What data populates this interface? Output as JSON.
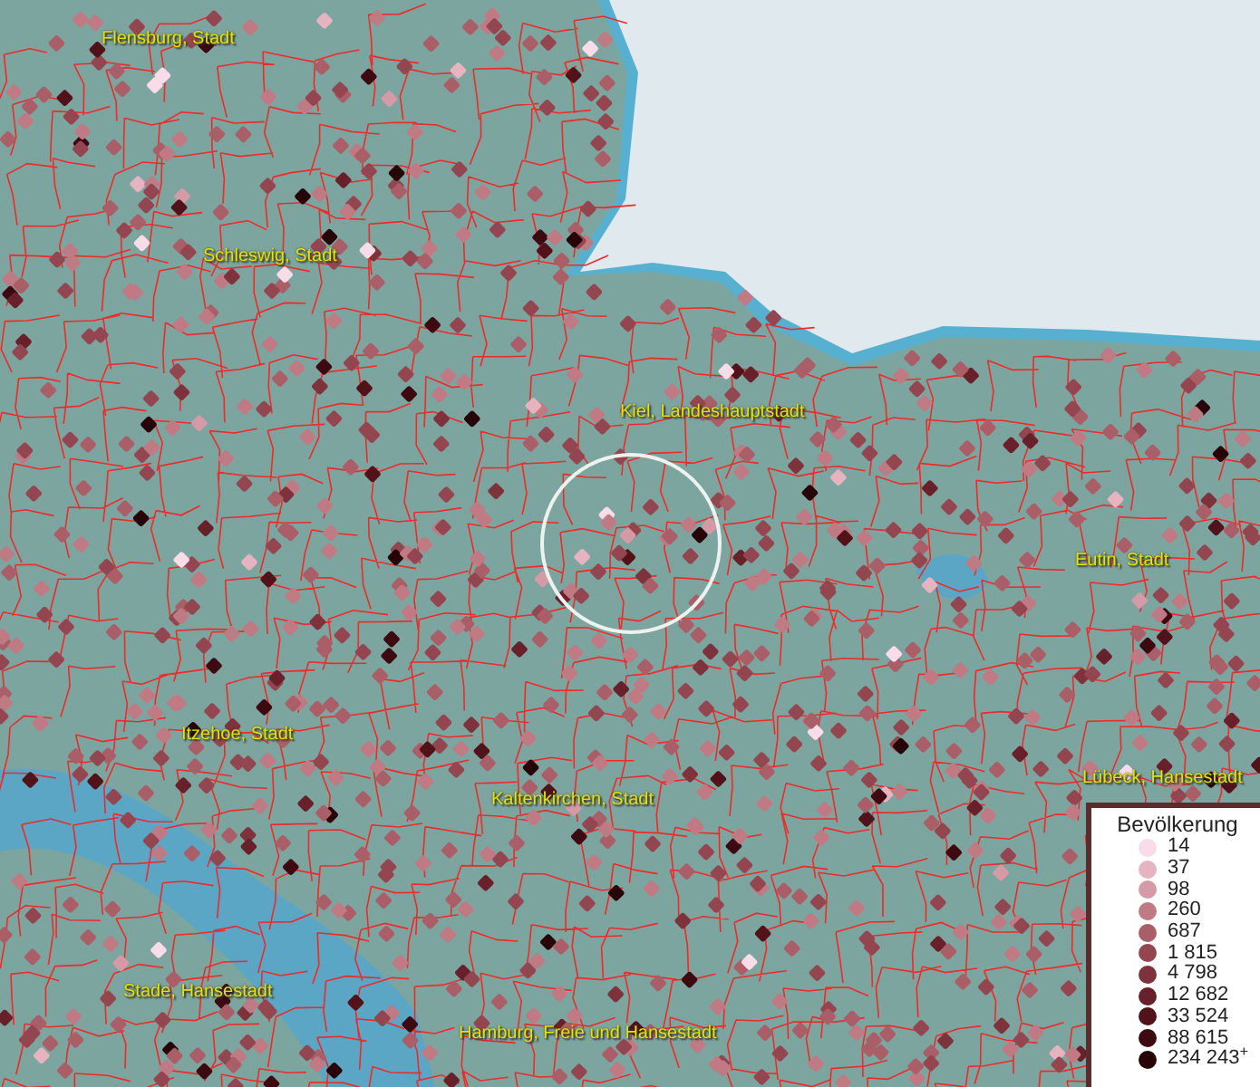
{
  "places": [
    {
      "label": "Flensburg, Stadt"
    },
    {
      "label": "Schleswig, Stadt"
    },
    {
      "label": "Kiel, Landeshauptstadt"
    },
    {
      "label": "Eutin, Stadt"
    },
    {
      "label": "Itzehoe, Stadt"
    },
    {
      "label": "Kaltenkirchen, Stadt"
    },
    {
      "label": "Lübeck, Hansestadt"
    },
    {
      "label": "Stade, Hansestadt"
    },
    {
      "label": "Hamburg, Freie und Hansestadt"
    }
  ],
  "legend": {
    "title": "Bevölkerung",
    "items": [
      {
        "label": "14",
        "color": "#f8dce8"
      },
      {
        "label": "37",
        "color": "#e6b4c0"
      },
      {
        "label": "98",
        "color": "#d49aa6"
      },
      {
        "label": "260",
        "color": "#c07a84"
      },
      {
        "label": "687",
        "color": "#aa5e68"
      },
      {
        "label": "1 815",
        "color": "#944650"
      },
      {
        "label": "4 798",
        "color": "#7e323c"
      },
      {
        "label": "12 682",
        "color": "#68202a"
      },
      {
        "label": "33 524",
        "color": "#52121a"
      },
      {
        "label": "88 615",
        "color": "#3c0a10"
      },
      {
        "label": "234 243$^{+}$",
        "color": "#260408"
      }
    ]
  }
}
